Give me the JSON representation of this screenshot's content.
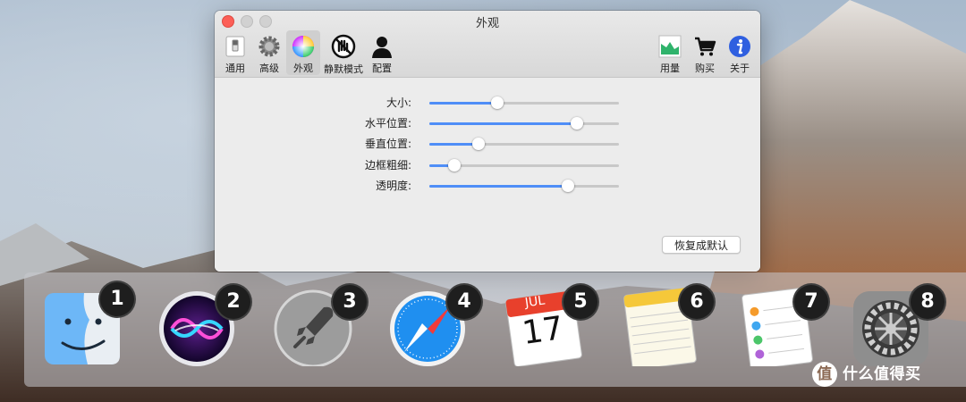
{
  "window": {
    "title": "外观"
  },
  "toolbar": {
    "left": [
      {
        "label": "通用",
        "icon": "switch-icon"
      },
      {
        "label": "高级",
        "icon": "gear-icon"
      },
      {
        "label": "外观",
        "icon": "color-wheel-icon"
      },
      {
        "label": "静默模式",
        "icon": "mute-hand-icon"
      },
      {
        "label": "配置",
        "icon": "person-icon"
      }
    ],
    "right": [
      {
        "label": "用量",
        "icon": "chart-icon"
      },
      {
        "label": "购买",
        "icon": "cart-icon"
      },
      {
        "label": "关于",
        "icon": "info-icon"
      }
    ],
    "active_tab": "外观"
  },
  "sliders": [
    {
      "label": "大小:",
      "value": 0.36
    },
    {
      "label": "水平位置:",
      "value": 0.78
    },
    {
      "label": "垂直位置:",
      "value": 0.26
    },
    {
      "label": "边框粗细:",
      "value": 0.13
    },
    {
      "label": "透明度:",
      "value": 0.73
    }
  ],
  "reset_button": "恢复成默认",
  "dock": {
    "apps": [
      {
        "name": "Finder",
        "badge": "1"
      },
      {
        "name": "Siri",
        "badge": "2"
      },
      {
        "name": "Launchpad",
        "badge": "3"
      },
      {
        "name": "Safari",
        "badge": "4"
      },
      {
        "name": "Calendar",
        "badge": "5",
        "month": "JUL",
        "day": "17"
      },
      {
        "name": "Notes",
        "badge": "6"
      },
      {
        "name": "Reminders",
        "badge": "7"
      },
      {
        "name": "System Preferences",
        "badge": "8"
      }
    ]
  },
  "watermark": "值 什么值得买",
  "colors": {
    "accent": "#4f8ef7",
    "close": "#fc5f57"
  }
}
